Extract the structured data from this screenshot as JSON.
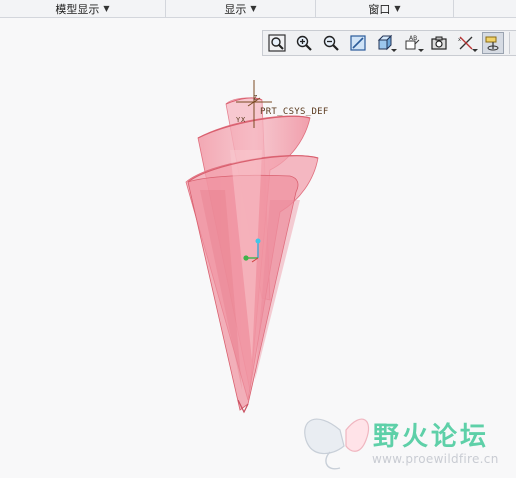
{
  "ribbon": {
    "groups": [
      {
        "label": "模型显示"
      },
      {
        "label": "显示"
      },
      {
        "label": "窗口"
      }
    ]
  },
  "toolbar": {
    "buttons": [
      {
        "icon": "refit-icon"
      },
      {
        "icon": "zoom-in-icon"
      },
      {
        "icon": "zoom-out-icon"
      },
      {
        "icon": "repaint-icon"
      },
      {
        "icon": "shading-style-icon"
      },
      {
        "icon": "saved-orientations-icon"
      },
      {
        "icon": "view-manager-icon"
      },
      {
        "icon": "datum-display-icon"
      },
      {
        "icon": "spin-center-icon"
      }
    ]
  },
  "viewport": {
    "csys_label": "PRT_CSYS_DEF",
    "axis_z": "Z",
    "axis_y": "Y",
    "axis_x": "X"
  },
  "watermark": {
    "title": "野火论坛",
    "url": "www.proewildfire.cn"
  },
  "colors": {
    "surface_fill": "#f3a1ad",
    "surface_edge": "#e0707f",
    "csys_color": "#7a4a22",
    "watermark_green": "#5ed0a8"
  }
}
